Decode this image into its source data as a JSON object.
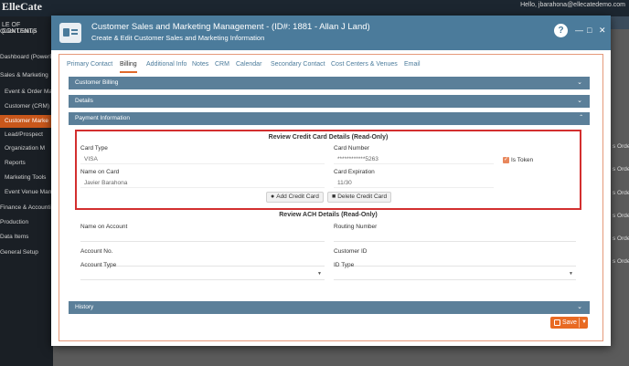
{
  "background": {
    "logo": "ElleCate",
    "user": "Hello, jbarahona@ellecatedemo.com",
    "sidebar": {
      "title": "LE OF CONTENTS",
      "items": [
        {
          "label": "Quick Lookup",
          "indent": false,
          "active": false
        },
        {
          "label": "Dashboard (PowerBI)",
          "indent": false,
          "active": false
        },
        {
          "label": "Sales & Marketing",
          "indent": false,
          "active": false
        },
        {
          "label": "Event & Order Mana",
          "indent": true,
          "active": false
        },
        {
          "label": "Customer (CRM)",
          "indent": true,
          "active": false
        },
        {
          "label": "Customer Marke",
          "indent": true,
          "active": true
        },
        {
          "label": "Lead/Prospect",
          "indent": true,
          "active": false
        },
        {
          "label": "Organization M",
          "indent": true,
          "active": false
        },
        {
          "label": "Reports",
          "indent": true,
          "active": false
        },
        {
          "label": "Marketing Tools",
          "indent": true,
          "active": false
        },
        {
          "label": "Event Venue Mana",
          "indent": true,
          "active": false
        },
        {
          "label": "Finance & Accounting",
          "indent": false,
          "active": false
        },
        {
          "label": "Production",
          "indent": false,
          "active": false
        },
        {
          "label": "Data Items",
          "indent": false,
          "active": false
        },
        {
          "label": "General Setup",
          "indent": false,
          "active": false
        }
      ]
    },
    "right_edge_items": [
      "s Order",
      "s Order",
      "s Order",
      "s Order",
      "s Order",
      "s Order"
    ]
  },
  "modal": {
    "title": "Customer Sales and Marketing Management - (ID#: 1881 - Allan J Land)",
    "subtitle": "Create & Edit Customer Sales and Marketing Information",
    "help_label": "?",
    "minimize_label": "—",
    "maximize_label": "□",
    "close_label": "✕"
  },
  "tabs": [
    {
      "label": "Primary Contact",
      "active": false
    },
    {
      "label": "Billing",
      "active": true
    },
    {
      "label": "Additional Info",
      "active": false
    },
    {
      "label": "Notes",
      "active": false
    },
    {
      "label": "CRM",
      "active": false
    },
    {
      "label": "Calendar",
      "active": false
    },
    {
      "label": "Secondary Contact",
      "active": false
    },
    {
      "label": "Cost Centers & Venues",
      "active": false
    },
    {
      "label": "Email",
      "active": false
    }
  ],
  "sections": {
    "customer_billing": {
      "label": "Customer Billing"
    },
    "details": {
      "label": "Details"
    },
    "payment_information": {
      "label": "Payment Information"
    },
    "history": {
      "label": "History"
    }
  },
  "credit_card": {
    "title": "Review Credit Card Details (Read-Only)",
    "card_type_label": "Card Type",
    "card_type_value": "VISA",
    "card_number_label": "Card Number",
    "card_number_value": "************5263",
    "is_token_label": "Is Token",
    "is_token_checked": true,
    "name_label": "Name on Card",
    "name_value": "Javier Barahona",
    "expiration_label": "Card Expiration",
    "expiration_value": "11/30",
    "add_button": "Add Credit Card",
    "delete_button": "Delete Credit Card"
  },
  "ach": {
    "title": "Review ACH Details (Read-Only)",
    "name_label": "Name on Account",
    "routing_label": "Routing Number",
    "account_no_label": "Account No.",
    "customer_id_label": "Customer ID",
    "account_type_label": "Account Type",
    "id_type_label": "ID Type"
  },
  "footer": {
    "save_label": "Save"
  },
  "colors": {
    "header": "#4b7b9b",
    "section_bar": "#5b7f99",
    "accent": "#e86a23",
    "highlight_border": "#d32f2f"
  }
}
